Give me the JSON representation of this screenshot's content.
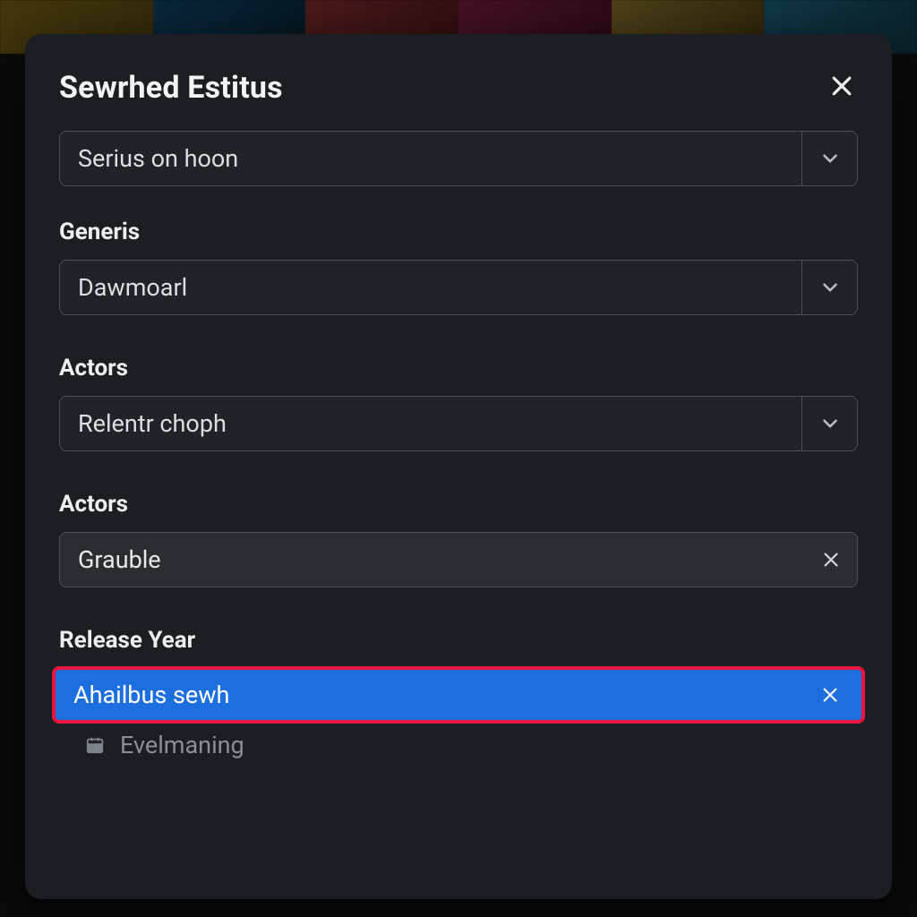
{
  "modal": {
    "title": "Sewrhed Estitus"
  },
  "fields": {
    "primary_select": {
      "value": "Serius on hoon"
    },
    "generis": {
      "label": "Generis",
      "value": "Dawmoarl"
    },
    "actors1": {
      "label": "Actors",
      "value": "Relentr choph"
    },
    "actors2": {
      "label": "Actors",
      "value": "Grauble"
    },
    "release_year": {
      "label": "Release Year",
      "highlighted_option": "Ahailbus sewh",
      "secondary_option": "Evelmaning"
    }
  }
}
